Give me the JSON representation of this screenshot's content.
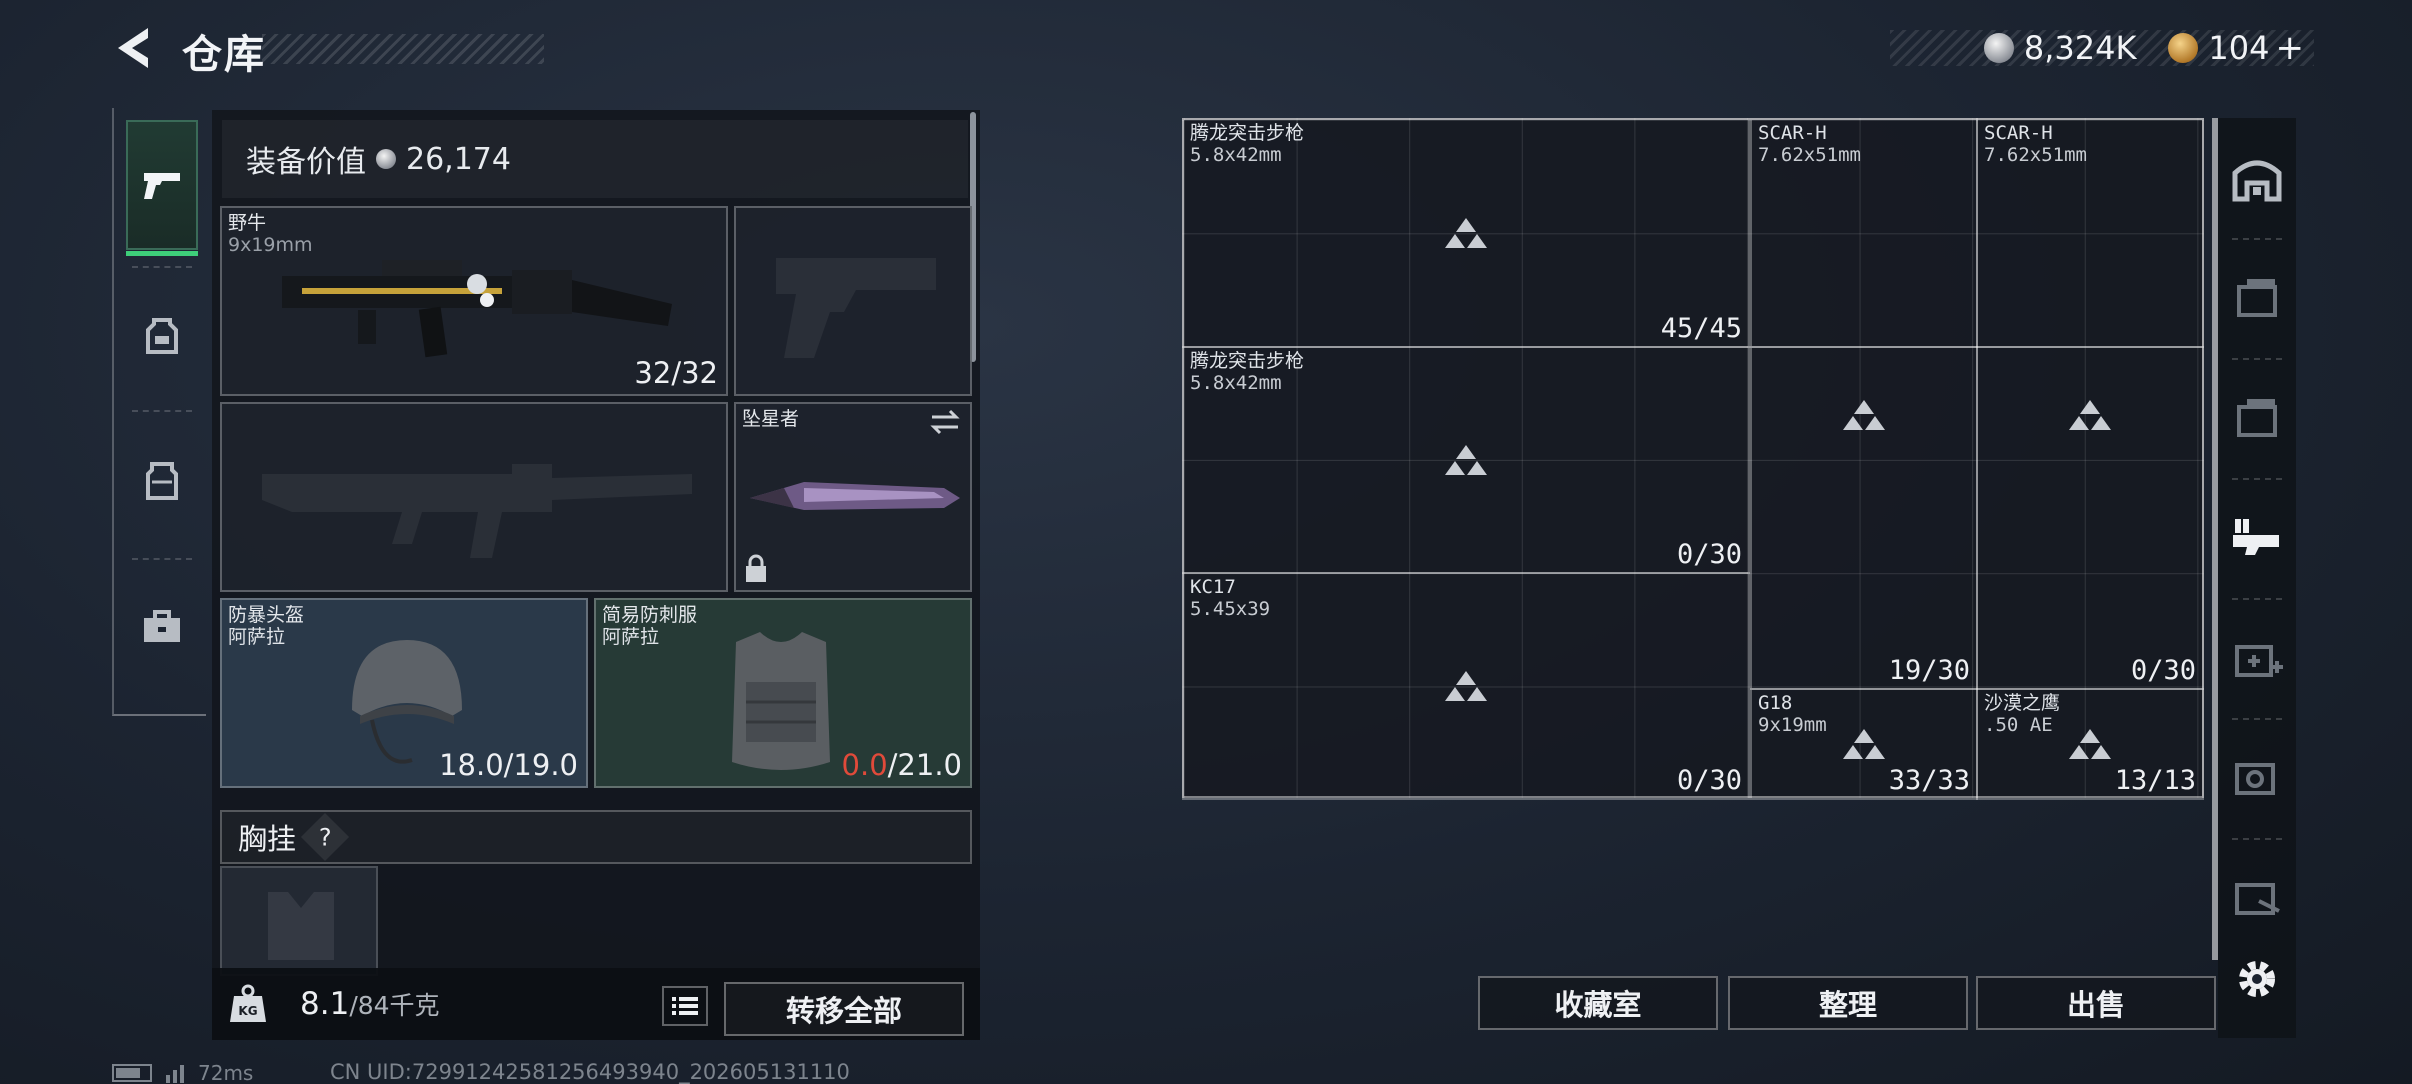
{
  "header": {
    "title": "仓库",
    "silver_amount": "8,324K",
    "gold_amount": "104",
    "plus_label": "+"
  },
  "left_panel": {
    "equip_value_label": "装备价值",
    "equip_value": "26,174",
    "primary_weapon": {
      "name": "野牛",
      "caliber": "9x19mm",
      "ammo": "32/32"
    },
    "melee": {
      "name": "坠星者"
    },
    "helmet": {
      "name": "防暴头盔",
      "maker": "阿萨拉",
      "durability": "18.0/19.0"
    },
    "armor": {
      "name": "简易防刺服",
      "maker": "阿萨拉",
      "durability_current": "0.0",
      "durability_max": "/21.0"
    },
    "chest_rig_label": "胸挂",
    "help_symbol": "?",
    "weight": "8.1",
    "weight_max": "/84千克",
    "transfer_all": "转移全部"
  },
  "storage": {
    "items": [
      {
        "name": "腾龙突击步枪",
        "caliber": "5.8x42mm",
        "count": "45/45"
      },
      {
        "name": "SCAR-H",
        "caliber": "7.62x51mm",
        "count": ""
      },
      {
        "name": "SCAR-H",
        "caliber": "7.62x51mm",
        "count": ""
      },
      {
        "name": "腾龙突击步枪",
        "caliber": "5.8x42mm",
        "count": "0/30"
      },
      {
        "name": "",
        "caliber": "",
        "count": "19/30"
      },
      {
        "name": "",
        "caliber": "",
        "count": "0/30"
      },
      {
        "name": "KC17",
        "caliber": "5.45x39",
        "count": "0/30"
      },
      {
        "name": "G18",
        "caliber": "9x19mm",
        "count": "33/33"
      },
      {
        "name": "沙漠之鹰",
        "caliber": ".50 AE",
        "count": "13/13"
      }
    ],
    "buttons": {
      "collection": "收藏室",
      "sort": "整理",
      "sell": "出售"
    }
  },
  "status": {
    "ping": "72ms",
    "uid": "CN UID:72991242581256493940_202605131110"
  },
  "colors": {
    "accent_green": "#3ecf7a",
    "durability_red": "#e04a3a"
  }
}
